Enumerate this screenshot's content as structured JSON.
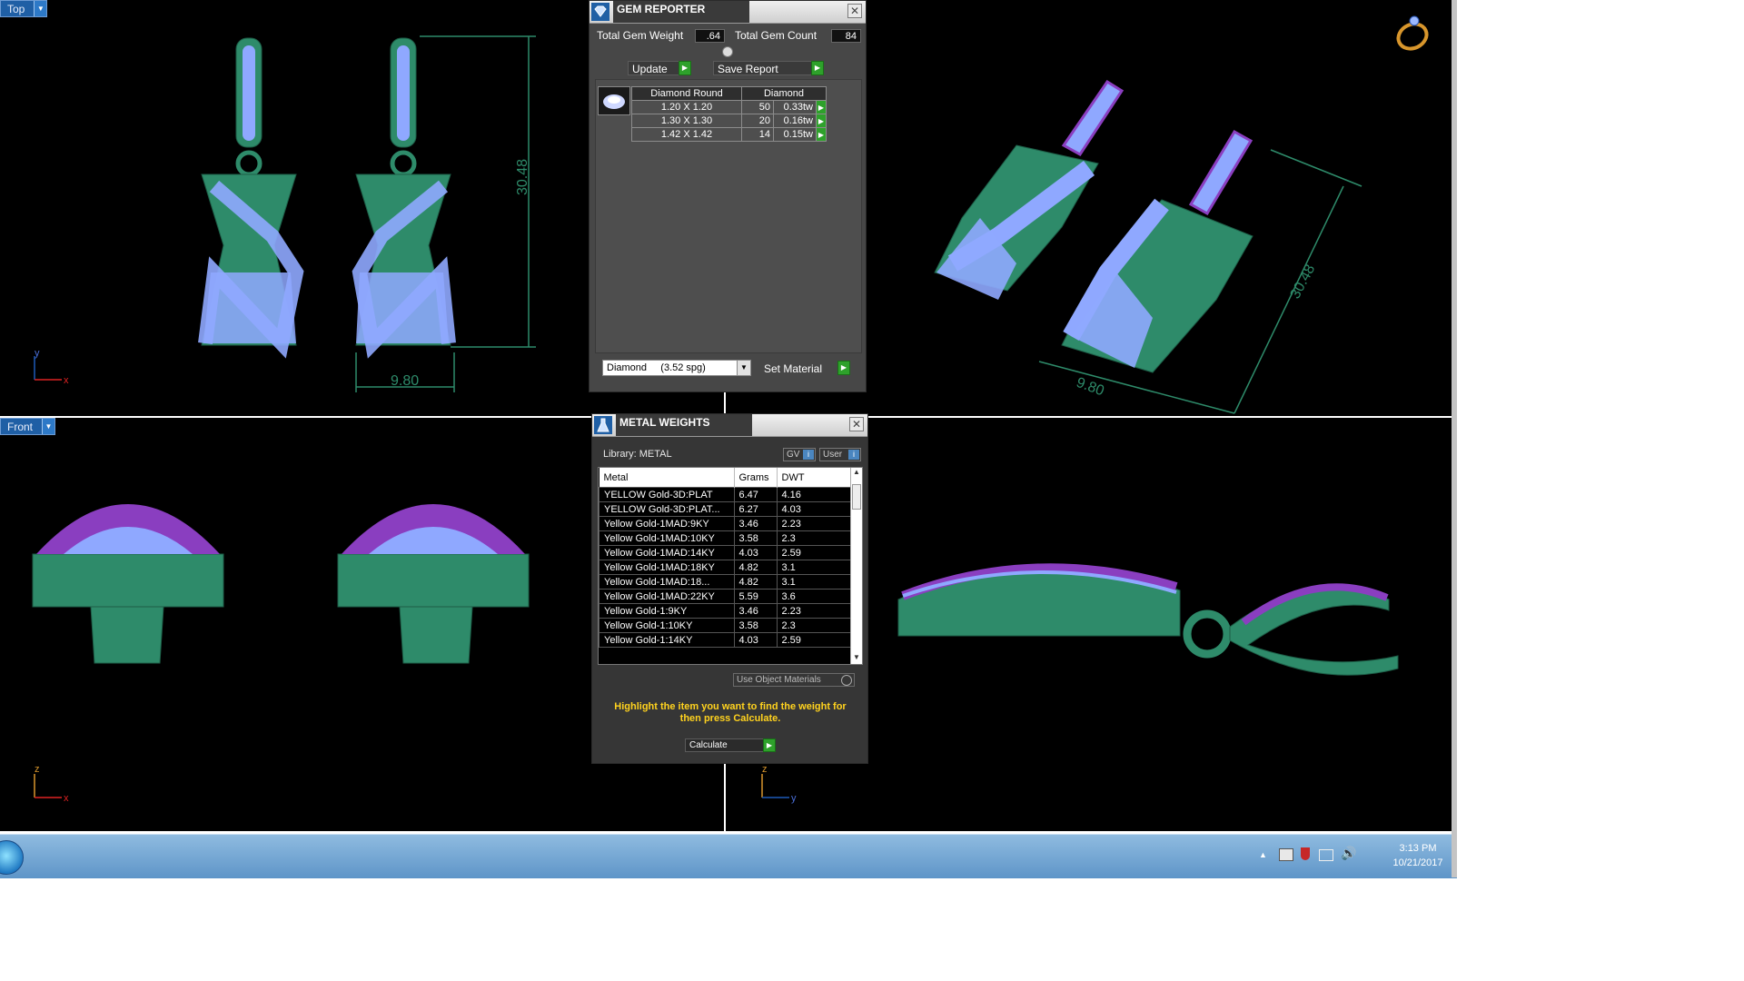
{
  "viewports": {
    "top": {
      "label": "Top",
      "axis_v": "y",
      "axis_h": "x",
      "dim_height": "30.48",
      "dim_width": "9.80"
    },
    "perspective": {
      "dim_height": "30.48",
      "dim_width": "9.80"
    },
    "front": {
      "label": "Front",
      "axis_v": "z",
      "axis_h": "x"
    },
    "side": {
      "axis_v": "z",
      "axis_h": "y"
    }
  },
  "gem_reporter": {
    "title": "GEM REPORTER",
    "total_weight_label": "Total Gem Weight",
    "total_weight_value": ".64",
    "total_count_label": "Total Gem Count",
    "total_count_value": "84",
    "update_label": "Update",
    "save_report_label": "Save Report",
    "table_header": {
      "shape": "Diamond Round",
      "material": "Diamond"
    },
    "rows": [
      {
        "size": "1.20 X 1.20",
        "count": "50",
        "weight": "0.33tw"
      },
      {
        "size": "1.30 X 1.30",
        "count": "20",
        "weight": "0.16tw"
      },
      {
        "size": "1.42 X 1.42",
        "count": "14",
        "weight": "0.15tw"
      }
    ],
    "material_select": "Diamond     (3.52 spg)",
    "set_material_label": "Set Material"
  },
  "metal_weights": {
    "title": "METAL WEIGHTS",
    "library_label": "Library: METAL",
    "gv_label": "GV",
    "user_label": "User",
    "columns": [
      "Metal",
      "Grams",
      "DWT"
    ],
    "rows": [
      {
        "metal": "YELLOW Gold-3D:PLAT",
        "grams": "6.47",
        "dwt": "4.16"
      },
      {
        "metal": "YELLOW Gold-3D:PLAT...",
        "grams": "6.27",
        "dwt": "4.03"
      },
      {
        "metal": "Yellow Gold-1MAD:9KY",
        "grams": "3.46",
        "dwt": "2.23"
      },
      {
        "metal": "Yellow Gold-1MAD:10KY",
        "grams": "3.58",
        "dwt": "2.3"
      },
      {
        "metal": "Yellow Gold-1MAD:14KY",
        "grams": "4.03",
        "dwt": "2.59"
      },
      {
        "metal": "Yellow Gold-1MAD:18KY",
        "grams": "4.82",
        "dwt": "3.1"
      },
      {
        "metal": "Yellow Gold-1MAD:18...",
        "grams": "4.82",
        "dwt": "3.1"
      },
      {
        "metal": "Yellow Gold-1MAD:22KY",
        "grams": "5.59",
        "dwt": "3.6"
      },
      {
        "metal": "Yellow Gold-1:9KY",
        "grams": "3.46",
        "dwt": "2.23"
      },
      {
        "metal": "Yellow Gold-1:10KY",
        "grams": "3.58",
        "dwt": "2.3"
      },
      {
        "metal": "Yellow Gold-1:14KY",
        "grams": "4.03",
        "dwt": "2.59"
      }
    ],
    "use_object_materials_label": "Use Object Materials",
    "hint": "Highlight the item you want to find the weight for then press Calculate.",
    "calculate_label": "Calculate"
  },
  "taskbar": {
    "time": "3:13 PM",
    "date": "10/21/2017"
  },
  "colors": {
    "metal": "#2e8b6a",
    "gem": "#8fa8ff",
    "prong": "#8a3ec0",
    "accent_go": "#2ea12b",
    "hint_text": "#ffd21e"
  }
}
